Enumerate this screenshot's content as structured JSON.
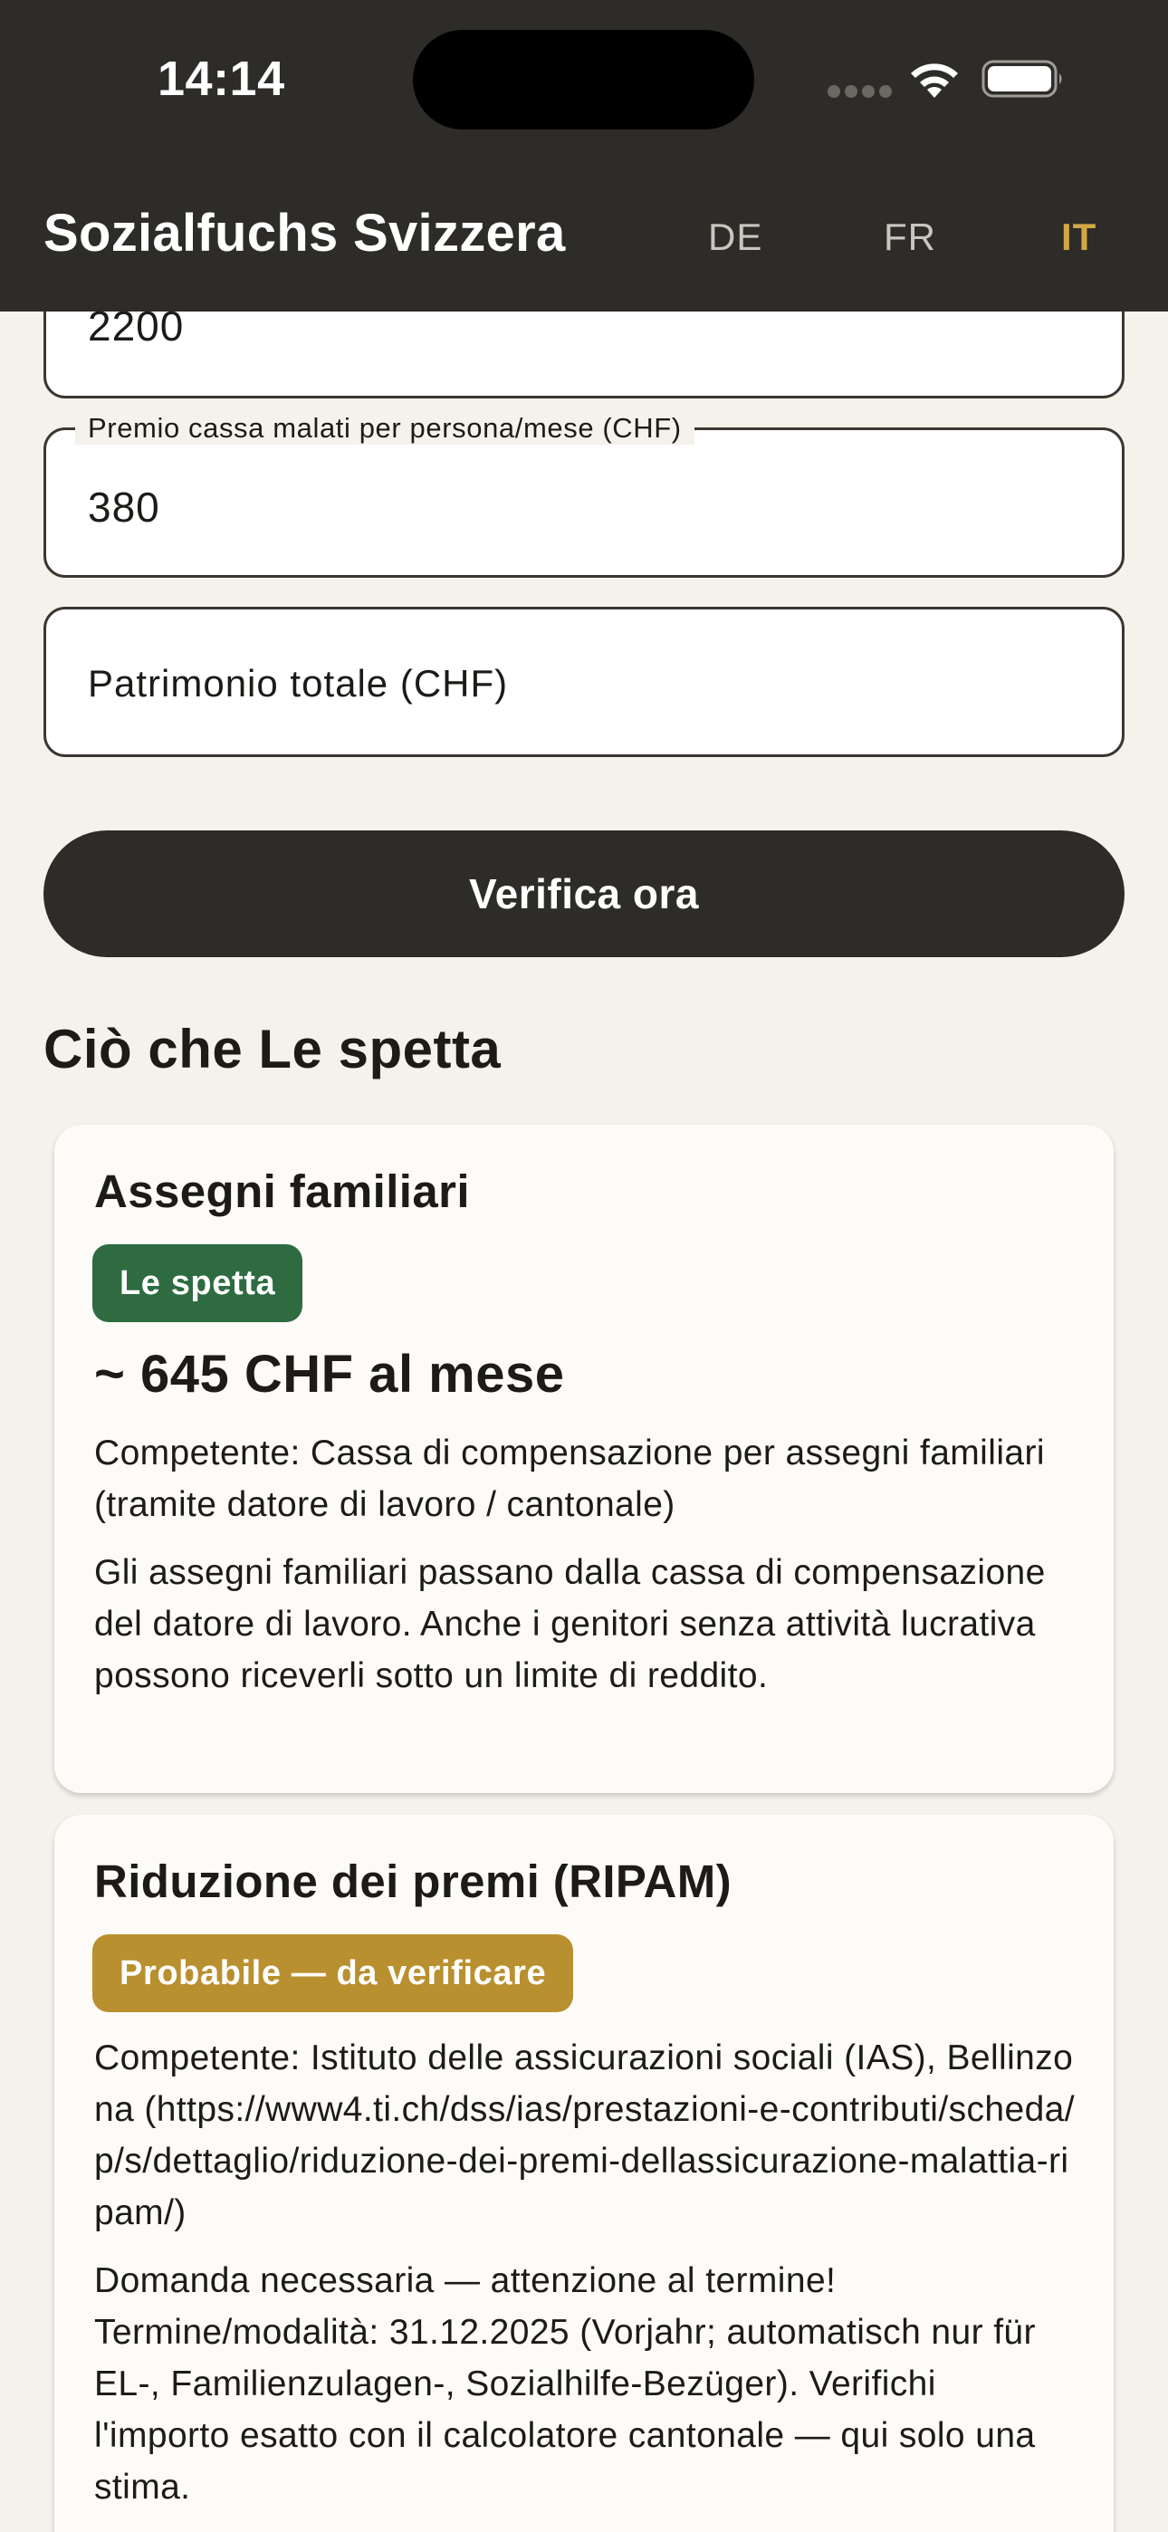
{
  "status_bar": {
    "time": "14:14"
  },
  "app_bar": {
    "title": "Sozialfuchs Svizzera",
    "languages": [
      "DE",
      "FR",
      "IT"
    ],
    "active_language": "IT"
  },
  "form": {
    "prev_field_value": "2200",
    "premium_label": "Premio cassa malati per persona/mese (CHF)",
    "premium_value": "380",
    "assets_placeholder": "Patrimonio totale (CHF)",
    "submit_label": "Verifica ora"
  },
  "results": {
    "title": "Ciò che Le spetta",
    "cards": [
      {
        "title": "Assegni familiari",
        "badge": "Le spetta",
        "badge_color": "#2e6b41",
        "amount": "~ 645 CHF al mese",
        "competent": "Competente: Cassa di compensazione per assegni familiari (tramite datore di lavoro / cantonale)",
        "description": "Gli assegni familiari passano dalla cassa di compensazione del datore di lavoro. Anche i genitori senza attività lucrativa possono riceverli sotto un limite di reddito."
      },
      {
        "title": "Riduzione dei premi (RIPAM)",
        "badge": "Probabile — da verificare",
        "badge_color": "#b9902f",
        "competent": "Competente: Istituto delle assicurazioni sociali (IAS), Bellinzona (https://www4.ti.ch/dss/ias/prestazioni-e-contributi/scheda/p/s/dettaglio/riduzione-dei-premi-dellassicurazione-malattia-ripam/)",
        "description": "Domanda necessaria — attenzione al termine! Termine/modalità: 31.12.2025 (Vorjahr; automatisch nur für EL-, Familienzulagen-, Sozialhilfe-Bezüger). Verifichi l'importo esatto con il calcolatore cantonale — qui solo una stima."
      }
    ]
  },
  "colors": {
    "app_bar_bg": "#2e2c28",
    "page_bg": "#f5f2ec",
    "accent_language": "#d2a845"
  }
}
